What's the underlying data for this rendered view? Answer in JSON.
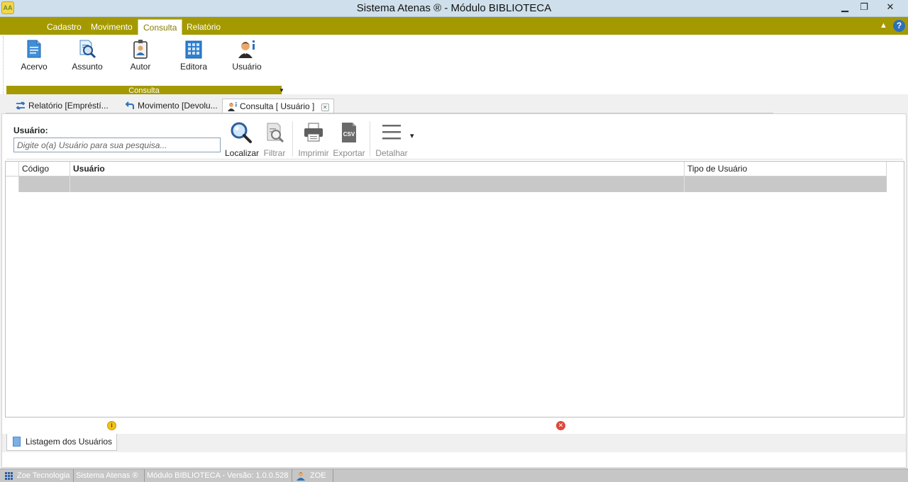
{
  "window": {
    "title": "Sistema Atenas ® - Módulo BIBLIOTECA",
    "app_icon_text": "AA",
    "minimize": "▁",
    "maximize": "❐",
    "close": "✕"
  },
  "ribbon": {
    "tabs": [
      {
        "label": "Cadastro"
      },
      {
        "label": "Movimento"
      },
      {
        "label": "Consulta",
        "active": true
      },
      {
        "label": "Relatório"
      }
    ],
    "collapse": "▲",
    "help": "?",
    "group": {
      "label": "Consulta",
      "buttons": [
        {
          "label": "Acervo",
          "icon": "document-icon"
        },
        {
          "label": "Assunto",
          "icon": "document-search-icon"
        },
        {
          "label": "Autor",
          "icon": "id-badge-icon"
        },
        {
          "label": "Editora",
          "icon": "building-icon"
        },
        {
          "label": "Usuário",
          "icon": "user-info-icon"
        }
      ]
    }
  },
  "doc_tabs": [
    {
      "label": "Relatório [Empréstí...",
      "icon": "swap-arrows-icon"
    },
    {
      "label": "Movimento [Devolu...",
      "icon": "return-arrow-icon"
    },
    {
      "label": "Consulta [ Usuário ]",
      "icon": "user-icon",
      "active": true
    }
  ],
  "search": {
    "label": "Usuário:",
    "placeholder": "Digite o(a) Usuário para sua pesquisa..."
  },
  "toolbar": {
    "localizar": "Localizar",
    "filtrar": "Filtrar",
    "imprimir": "Imprimir",
    "exportar": "Exportar",
    "csv_text": "CSV",
    "detalhar": "Detalhar",
    "dropdown": "▾"
  },
  "grid": {
    "columns": [
      "Código",
      "Usuário",
      "Tipo de Usuário"
    ],
    "rows": []
  },
  "status_icons": {
    "info": "i",
    "error": "✕"
  },
  "bottom_tab": {
    "label": "Listagem dos Usuários"
  },
  "statusbar": {
    "company": "Zoe Tecnologia",
    "system": "Sistema Atenas ®",
    "module": "Módulo BIBLIOTECA - Versão: 1.0.0.528",
    "user": "ZOE"
  },
  "colors": {
    "ribbon": "#a49a00",
    "titlebar": "#cfe0ec",
    "accent_blue": "#2e6fba"
  }
}
